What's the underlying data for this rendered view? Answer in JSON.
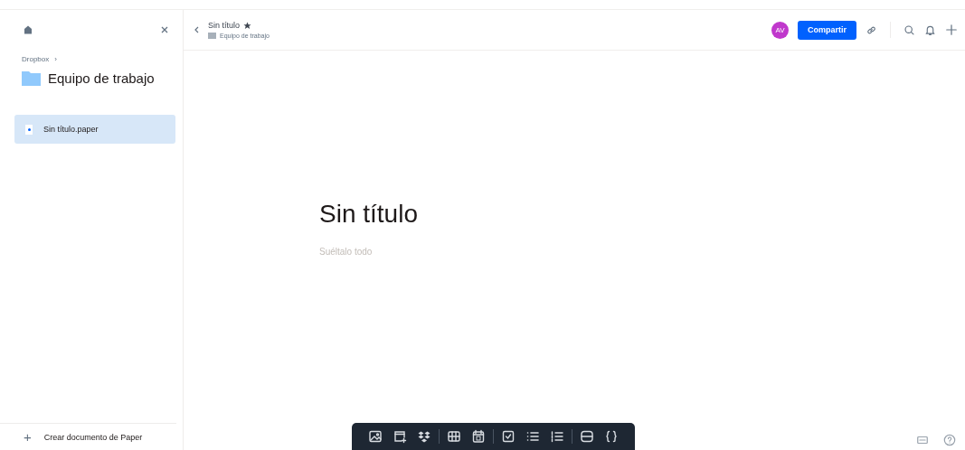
{
  "sidebar": {
    "breadcrumb": "Dropbox",
    "breadcrumb_sep": "›",
    "folder": "Equipo de trabajo",
    "files": [
      {
        "name": "Sin título.paper",
        "selected": true
      }
    ],
    "create": {
      "icon": "+",
      "label": "Crear documento de Paper"
    }
  },
  "header": {
    "title": "Sin título",
    "starred": true,
    "folder": "Equipo de trabajo",
    "avatar": "AV",
    "share": "Compartir"
  },
  "document": {
    "title": "Sin título",
    "placeholder": "Suéltalo todo"
  },
  "toolbar": [
    [
      {
        "kind": "image"
      },
      {
        "kind": "media-add"
      },
      {
        "kind": "box"
      }
    ],
    [
      {
        "kind": "table"
      },
      {
        "kind": "calendar"
      }
    ],
    [
      {
        "kind": "checkbox"
      },
      {
        "kind": "bullets"
      },
      {
        "kind": "numbered"
      }
    ],
    [
      {
        "kind": "divider"
      },
      {
        "kind": "code"
      }
    ]
  ]
}
